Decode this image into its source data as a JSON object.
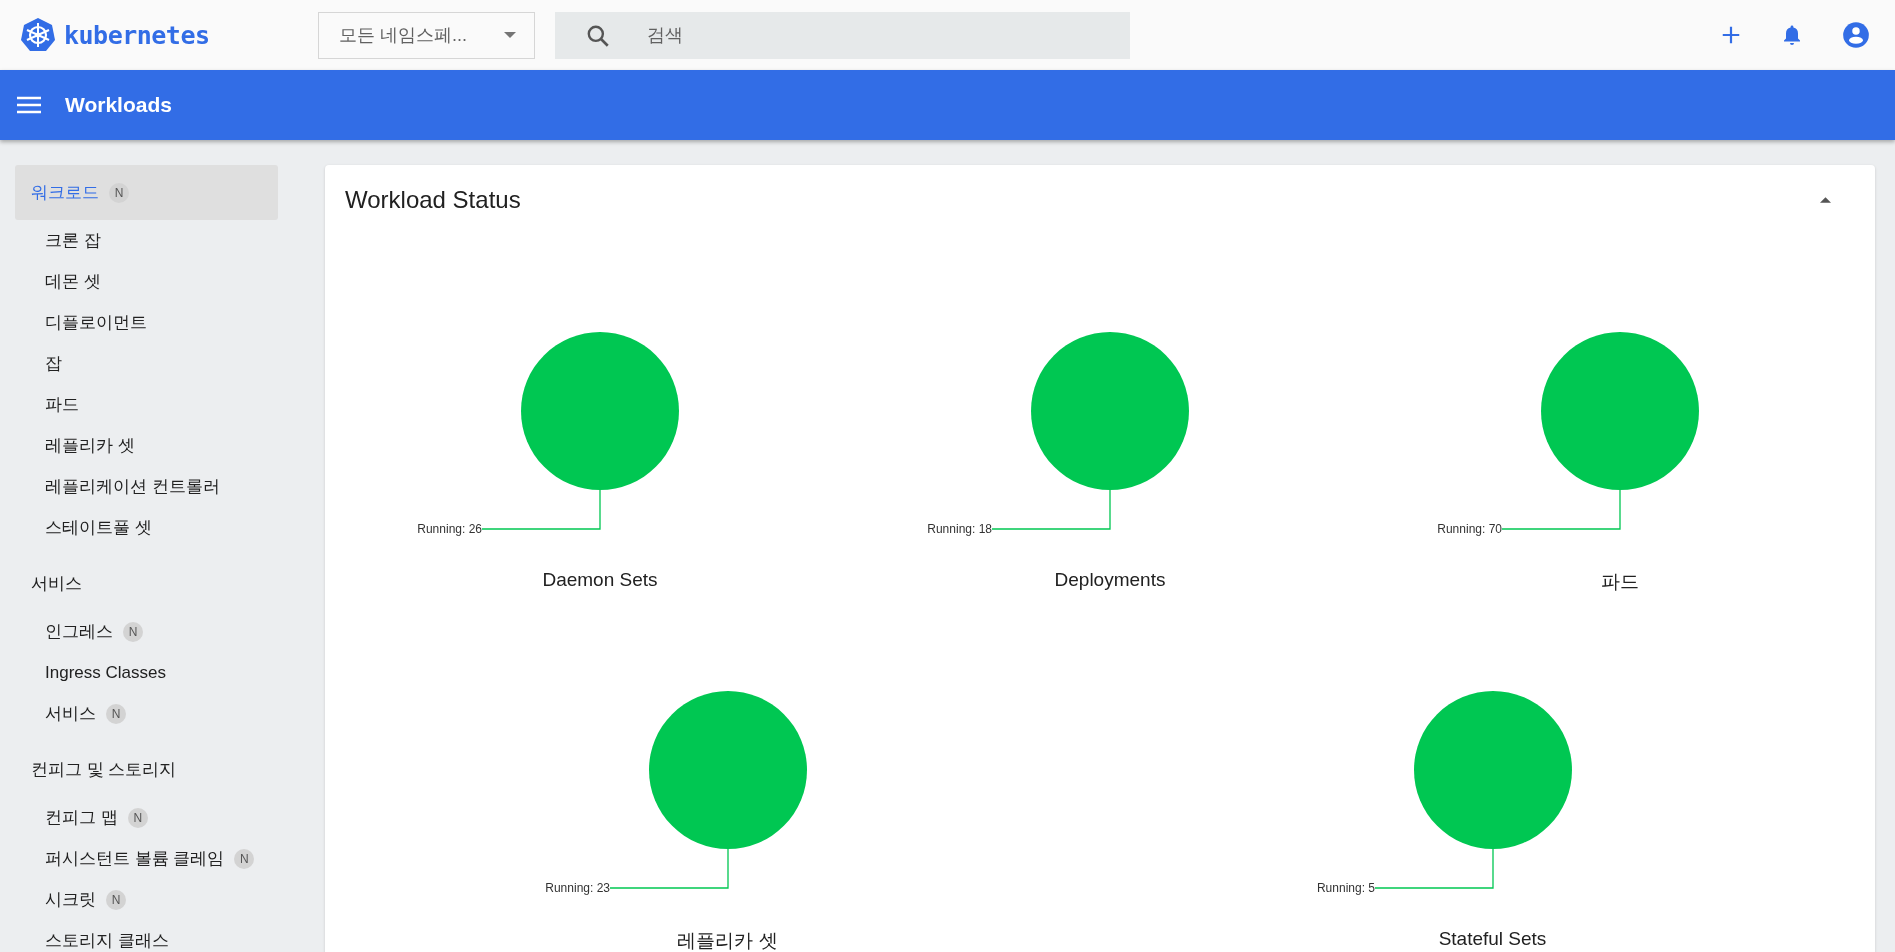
{
  "header": {
    "logo_text": "kubernetes",
    "namespace": {
      "value": "모든 네임스페..."
    },
    "search": {
      "placeholder": "검색"
    }
  },
  "toolbar": {
    "title": "Workloads"
  },
  "sidebar": {
    "sections": [
      {
        "label": "워크로드",
        "selected": true,
        "badge": "N",
        "children": [
          {
            "label": "크론 잡",
            "selected": false
          },
          {
            "label": "데몬 셋",
            "selected": false
          },
          {
            "label": "디플로이먼트",
            "selected": false
          },
          {
            "label": "잡",
            "selected": false
          },
          {
            "label": "파드",
            "selected": false
          },
          {
            "label": "레플리카 셋",
            "selected": false
          },
          {
            "label": "레플리케이션 컨트롤러",
            "selected": false
          },
          {
            "label": "스테이트풀 셋",
            "selected": false
          }
        ]
      },
      {
        "label": "서비스",
        "selected": false,
        "children": [
          {
            "label": "인그레스",
            "selected": false,
            "badge": "N"
          },
          {
            "label": "Ingress Classes",
            "selected": false
          },
          {
            "label": "서비스",
            "selected": false,
            "badge": "N"
          }
        ]
      },
      {
        "label": "컨피그 및 스토리지",
        "selected": false,
        "children": [
          {
            "label": "컨피그 맵",
            "selected": false,
            "badge": "N"
          },
          {
            "label": "퍼시스턴트 볼륨 클레임",
            "selected": false,
            "badge": "N"
          },
          {
            "label": "시크릿",
            "selected": false,
            "badge": "N"
          },
          {
            "label": "스토리지 클래스",
            "selected": false
          }
        ]
      }
    ]
  },
  "workload_status": {
    "title": "Workload Status",
    "expanded": true,
    "rows": [
      [
        {
          "chart_data": {
            "type": "pie",
            "title": "Daemon Sets",
            "series": [
              {
                "color": "#00c752",
                "values": [
                  100
                ]
              }
            ],
            "value_labels": [
              "Running: 26"
            ]
          }
        },
        {
          "chart_data": {
            "type": "pie",
            "title": "Deployments",
            "series": [
              {
                "color": "#00c752",
                "values": [
                  100
                ]
              }
            ],
            "value_labels": [
              "Running: 18"
            ]
          }
        },
        {
          "chart_data": {
            "type": "pie",
            "title": "파드",
            "series": [
              {
                "color": "#00c752",
                "values": [
                  100
                ]
              }
            ],
            "value_labels": [
              "Running: 70"
            ]
          }
        }
      ],
      [
        {
          "chart_data": {
            "type": "pie",
            "title": "레플리카 셋",
            "series": [
              {
                "color": "#00c752",
                "values": [
                  100
                ]
              }
            ],
            "value_labels": [
              "Running: 23"
            ]
          }
        },
        {
          "chart_data": {
            "type": "pie",
            "title": "Stateful Sets",
            "series": [
              {
                "color": "#00c752",
                "values": [
                  100
                ]
              }
            ],
            "value_labels": [
              "Running: 5"
            ]
          }
        }
      ]
    ]
  }
}
